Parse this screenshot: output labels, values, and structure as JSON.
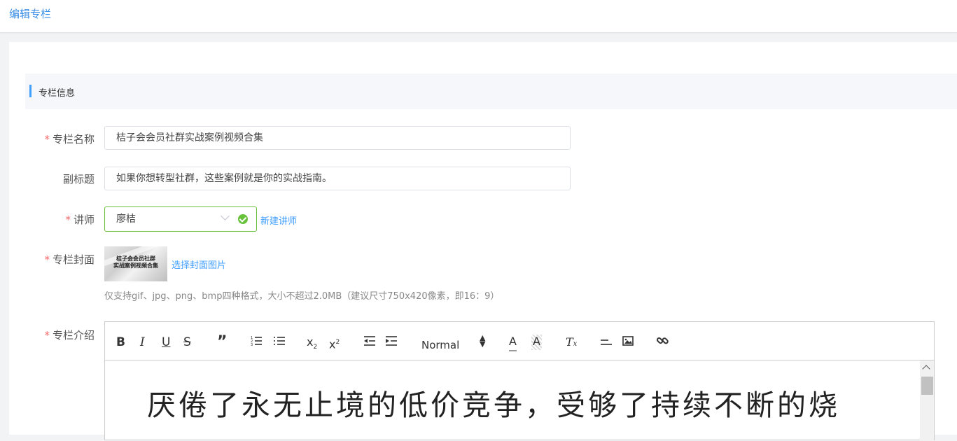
{
  "header": {
    "title": "编辑专栏"
  },
  "section": {
    "title": "专栏信息"
  },
  "form": {
    "name": {
      "label": "专栏名称",
      "value": "桔子会会员社群实战案例视频合集"
    },
    "subtitle": {
      "label": "副标题",
      "value": "如果你想转型社群，这些案例就是你的实战指南。"
    },
    "lecturer": {
      "label": "讲师",
      "value": "廖桔",
      "new_link": "新建讲师"
    },
    "cover": {
      "label": "专栏封面",
      "image_text_line1": "桔子会会员社群",
      "image_text_line2": "实战案例视频合集",
      "select_link": "选择封面图片",
      "hint": "仅支持gif、jpg、png、bmp四种格式，大小不超过2.0MB（建议尺寸750x420像素，即16：9）"
    },
    "intro": {
      "label": "专栏介绍",
      "format_select": "Normal",
      "content": "厌倦了永无止境的低价竞争，受够了持续不断的烧"
    }
  },
  "required_mark": "*",
  "colors": {
    "accent": "#409eff",
    "success": "#67c23a",
    "required": "#f56c6c"
  }
}
